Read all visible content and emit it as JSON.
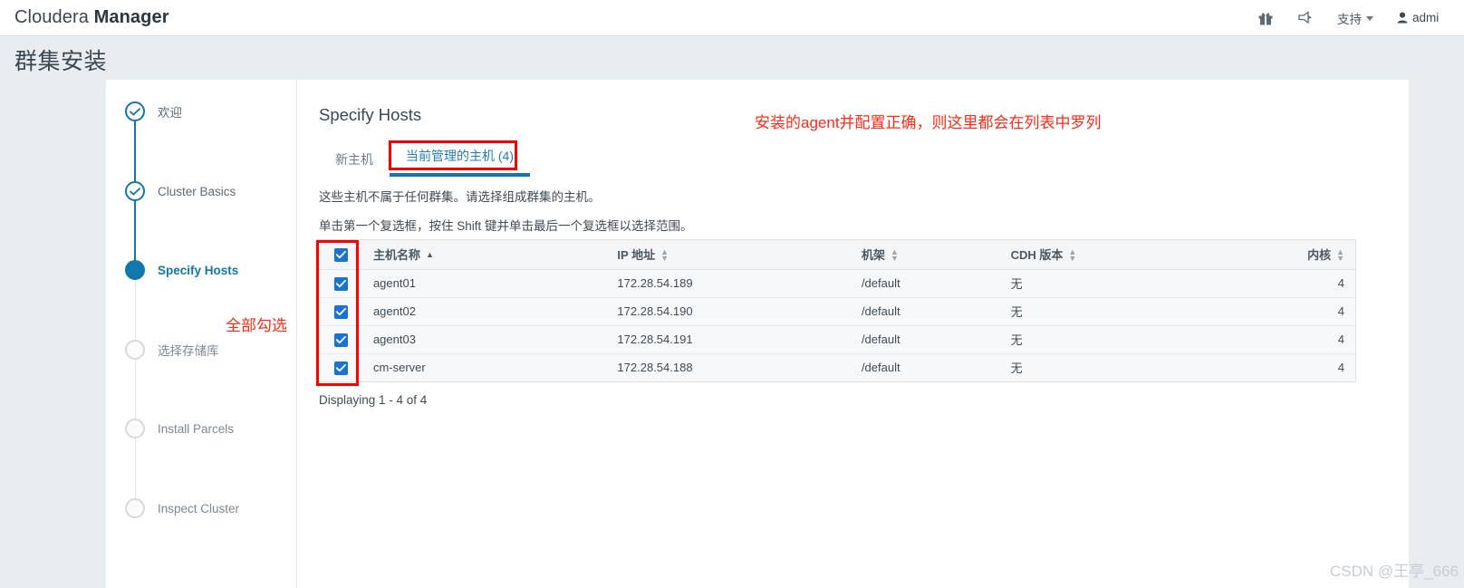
{
  "navbar": {
    "brand_prefix": "Cloudera ",
    "brand_bold": "Manager",
    "gift_icon": "gift-icon",
    "announcement_icon": "announcement-icon",
    "support_label": "支持",
    "user_label": "admi"
  },
  "page": {
    "title": "群集安装"
  },
  "wizard": {
    "steps": [
      {
        "label": "欢迎",
        "state": "done"
      },
      {
        "label": "Cluster Basics",
        "state": "done"
      },
      {
        "label": "Specify Hosts",
        "state": "current"
      },
      {
        "label": "选择存储库",
        "state": "pending"
      },
      {
        "label": "Install Parcels",
        "state": "pending"
      },
      {
        "label": "Inspect Cluster",
        "state": "pending"
      }
    ]
  },
  "main": {
    "title": "Specify Hosts",
    "tabs": [
      {
        "label": "新主机",
        "active": false
      },
      {
        "label": "当前管理的主机 (4)",
        "active": true
      }
    ],
    "notes": [
      "这些主机不属于任何群集。请选择组成群集的主机。",
      "单击第一个复选框，按住 Shift 键并单击最后一个复选框以选择范围。"
    ],
    "table": {
      "headers": [
        {
          "label": "主机名称",
          "sort": "asc"
        },
        {
          "label": "IP 地址",
          "sort": "none"
        },
        {
          "label": "机架",
          "sort": "none"
        },
        {
          "label": "CDH 版本",
          "sort": "none"
        },
        {
          "label": "内核",
          "sort": "none"
        }
      ],
      "rows": [
        {
          "checked": true,
          "host": "agent01",
          "ip": "172.28.54.189",
          "rack": "/default",
          "cdh": "无",
          "cores": "4"
        },
        {
          "checked": true,
          "host": "agent02",
          "ip": "172.28.54.190",
          "rack": "/default",
          "cdh": "无",
          "cores": "4"
        },
        {
          "checked": true,
          "host": "agent03",
          "ip": "172.28.54.191",
          "rack": "/default",
          "cdh": "无",
          "cores": "4"
        },
        {
          "checked": true,
          "host": "cm-server",
          "ip": "172.28.54.188",
          "rack": "/default",
          "cdh": "无",
          "cores": "4"
        }
      ],
      "header_checkbox_checked": true
    },
    "displaying": "Displaying 1 - 4 of 4"
  },
  "annotations": {
    "top_note": "安装的agent并配置正确，则这里都会在列表中罗列",
    "checkbox_note": "全部勾选"
  },
  "watermark": "CSDN @王亭_666",
  "colors": {
    "accent": "#1277ad",
    "annotation_red": "#fe0000",
    "checkbox_blue": "#1a73d2",
    "page_bg": "#e9edf0"
  }
}
